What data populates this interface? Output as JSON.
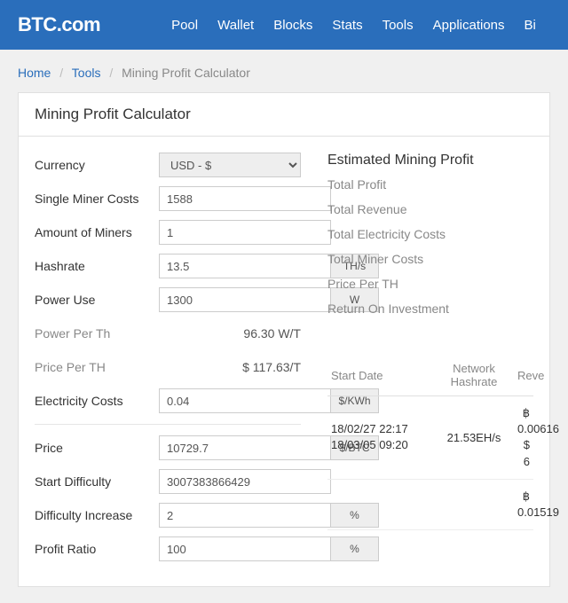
{
  "header": {
    "logo": "BTC.com",
    "nav": [
      "Pool",
      "Wallet",
      "Blocks",
      "Stats",
      "Tools",
      "Applications",
      "Bi"
    ]
  },
  "breadcrumb": {
    "home": "Home",
    "tools": "Tools",
    "current": "Mining Profit Calculator"
  },
  "page_title": "Mining Profit Calculator",
  "form": {
    "currency": {
      "label": "Currency",
      "value": "USD - $"
    },
    "single_miner_costs": {
      "label": "Single Miner Costs",
      "value": "1588"
    },
    "amount_of_miners": {
      "label": "Amount of Miners",
      "value": "1"
    },
    "hashrate": {
      "label": "Hashrate",
      "value": "13.5",
      "unit": "TH/s"
    },
    "power_use": {
      "label": "Power Use",
      "value": "1300",
      "unit": "W"
    },
    "power_per_th": {
      "label": "Power Per Th",
      "value": "96.30 W/T"
    },
    "price_per_th": {
      "label": "Price Per TH",
      "value": "$ 117.63/T"
    },
    "electricity_costs": {
      "label": "Electricity Costs",
      "value": "0.04",
      "unit": "$/KWh"
    },
    "price": {
      "label": "Price",
      "value": "10729.7",
      "unit": "$/BTC"
    },
    "start_difficulty": {
      "label": "Start Difficulty",
      "value": "3007383866429"
    },
    "difficulty_increase": {
      "label": "Difficulty Increase",
      "value": "2",
      "unit": "%"
    },
    "profit_ratio": {
      "label": "Profit Ratio",
      "value": "100",
      "unit": "%"
    }
  },
  "results": {
    "title": "Estimated Mining Profit",
    "stats": [
      "Total Profit",
      "Total Revenue",
      "Total Electricity Costs",
      "Total Miner Costs",
      "Price Per TH",
      "Return On Investment"
    ]
  },
  "table": {
    "headers": {
      "start_date": "Start Date",
      "network_hashrate": "Network Hashrate",
      "revenue": "Reve"
    },
    "rows": [
      {
        "date1": "18/02/27 22:17",
        "date2": "18/03/05 09:20",
        "hashrate": "21.53EH/s",
        "rev1": "฿ 0.00616",
        "rev2": "$ 6"
      },
      {
        "date1": "",
        "date2": "",
        "hashrate": "",
        "rev1": "฿ 0.01519",
        "rev2": ""
      }
    ]
  }
}
